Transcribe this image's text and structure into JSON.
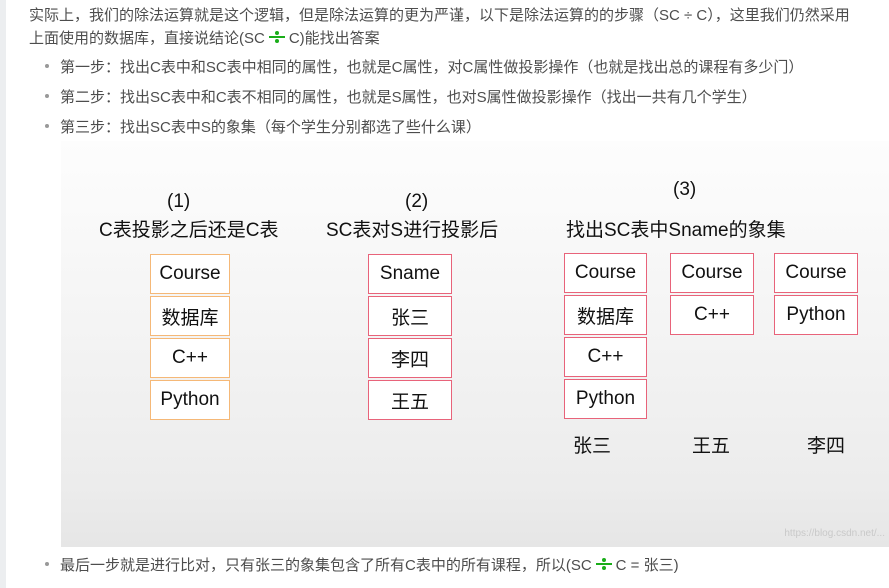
{
  "paragraph": {
    "line1": "实际上，我们的除法运算就是这个逻辑，但是除法运算的更为严谨，以下是除法运算的的步骤（SC ÷ C），这里我们仍然采用",
    "line2_before": "上面使用的数据库，直接说结论(SC",
    "line2_after": "C)能找出答案"
  },
  "steps": [
    "第一步：找出C表中和SC表中相同的属性，也就是C属性，对C属性做投影操作（也就是找出总的课程有多少门）",
    "第二步：找出SC表中和C表不相同的属性，也就是S属性，也对S属性做投影操作（找出一共有几个学生）",
    "第三步：找出SC表中S的象集（每个学生分别都选了些什么课）"
  ],
  "figure": {
    "p1": {
      "num": "(1)",
      "title": "C表投影之后还是C表",
      "cells": [
        "Course",
        "数据库",
        "C++",
        "Python"
      ]
    },
    "p2": {
      "num": "(2)",
      "title": "SC表对S进行投影后",
      "cells": [
        "Sname",
        "张三",
        "李四",
        "王五"
      ]
    },
    "p3": {
      "num": "(3)",
      "title": "找出SC表中Sname的象集",
      "t1": {
        "cells": [
          "Course",
          "数据库",
          "C++",
          "Python"
        ],
        "label": "张三"
      },
      "t2": {
        "cells": [
          "Course",
          "C++"
        ],
        "label": "王五"
      },
      "t3": {
        "cells": [
          "Course",
          "Python"
        ],
        "label": "李四"
      }
    },
    "watermark": "https://blog.csdn.net/..."
  },
  "final": {
    "before": "最后一步就是进行比对，只有张三的象集包含了所有C表中的所有课程，所以(SC",
    "after": "C = 张三)"
  },
  "colors": {
    "orange_border": "#f5b877",
    "pink_border": "#e8637a",
    "divide_symbol": "#1aad19"
  }
}
